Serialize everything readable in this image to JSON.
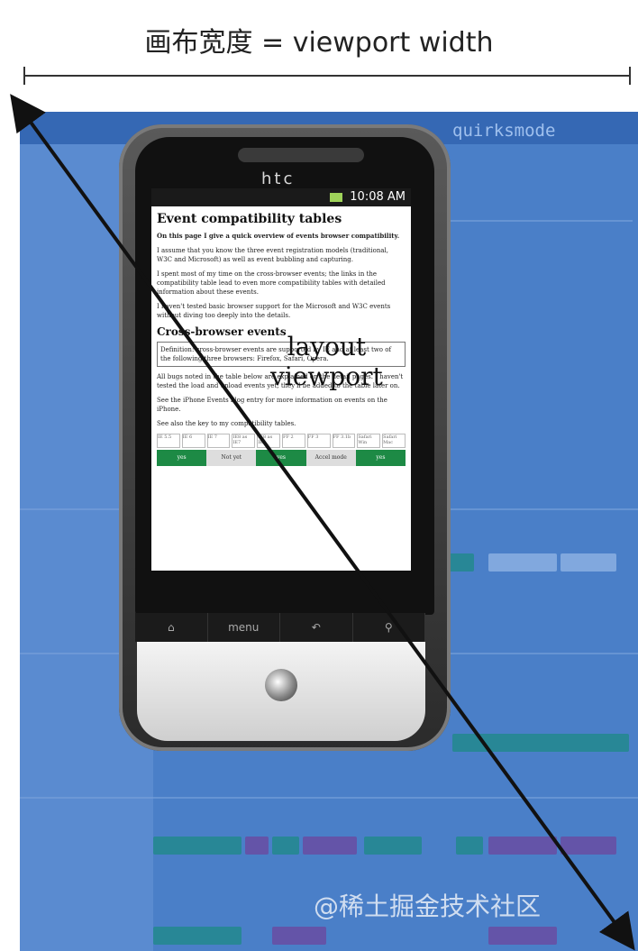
{
  "title": "画布宽度 = viewport width",
  "canvas": {
    "mode_title": "quirksmode",
    "watermark": "@稀土掘金技术社区"
  },
  "phone": {
    "brand": "htc",
    "status_time": "10:08 AM",
    "nav": {
      "home": "⌂",
      "menu": "menu",
      "back": "↶",
      "search": "⚲"
    }
  },
  "screen_doc": {
    "heading": "Event compatibility tables",
    "intro_bold": "On this page I give a quick overview of events browser compatibility.",
    "p1": "I assume that you know the three event registration models (traditional, W3C and Microsoft) as well as event bubbling and capturing.",
    "p2": "I spent most of my time on the cross-browser events; the links in the compatibility table lead to even more compatibility tables with detailed information about these events.",
    "p3": "I haven't tested basic browser support for the Microsoft and W3C events without diving too deeply into the details.",
    "section": "Cross-browser events",
    "boxed_text": "Definition: cross-browser events are supported by IE and at least two of the following three browsers: Firefox, Safari, Opera.",
    "p4": "All bugs noted in the table below are explained on the detail pages. I haven't tested the load and unload events yet; they'll be added to the table later on.",
    "p5": "See the iPhone Events blog entry for more information on events on the iPhone.",
    "p6": "See also the key to my compatibility tables.",
    "cells": [
      "IE 5.5",
      "IE 6",
      "IE 7",
      "IE8 as IE7",
      "IE8 as IE8",
      "FF 2",
      "FF 3",
      "FF 3.1b",
      "Safari Win",
      "Safari Mac"
    ],
    "green_labels": [
      "yes",
      "Not yet",
      "yes",
      "Accel mode",
      "yes"
    ]
  },
  "overlay": {
    "line1": "layout",
    "line2": "viewport"
  },
  "colors": {
    "canvas_blue": "#4a7fc8",
    "arrow": "#111111"
  }
}
